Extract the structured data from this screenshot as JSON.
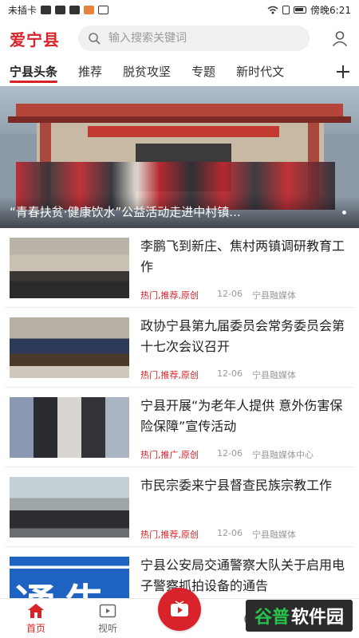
{
  "status_bar": {
    "carrier": "未插卡",
    "time": "傍晚6:21"
  },
  "header": {
    "logo": "爱宁县",
    "search_placeholder": "输入搜索关键词"
  },
  "tabs": [
    {
      "label": "宁县头条",
      "active": true
    },
    {
      "label": "推荐"
    },
    {
      "label": "脱贫攻坚"
    },
    {
      "label": "专题"
    },
    {
      "label": "新时代文"
    }
  ],
  "banner": {
    "caption": "“青春扶贫·健康饮水”公益活动走进中村镇..."
  },
  "news": [
    {
      "title": "李鹏飞到新庄、焦村两镇调研教育工作",
      "tags": "热门,推荐,原创",
      "date": "12-06",
      "source": "宁县融媒体"
    },
    {
      "title": "政协宁县第九届委员会常务委员会第十七次会议召开",
      "tags": "热门,推荐,原创",
      "date": "12-06",
      "source": "宁县融媒体"
    },
    {
      "title": "宁县开展“为老年人提供 意外伤害保险保障”宣传活动",
      "tags": "热门,推广,原创",
      "date": "12-06",
      "source": "宁县融媒体中心"
    },
    {
      "title": "市民宗委来宁县督查民族宗教工作",
      "tags": "热门,推荐,原创",
      "date": "12-06",
      "source": "宁县融媒体"
    },
    {
      "title": "宁县公安局交通警察大队关于启用电子警察抓拍设备的通告",
      "thumb_text": "通告"
    }
  ],
  "bottom_nav": {
    "home": "首页",
    "video": "视听"
  },
  "watermark": {
    "part1": "谷普",
    "part2": "软件园"
  },
  "colors": {
    "accent": "#d8232a"
  }
}
